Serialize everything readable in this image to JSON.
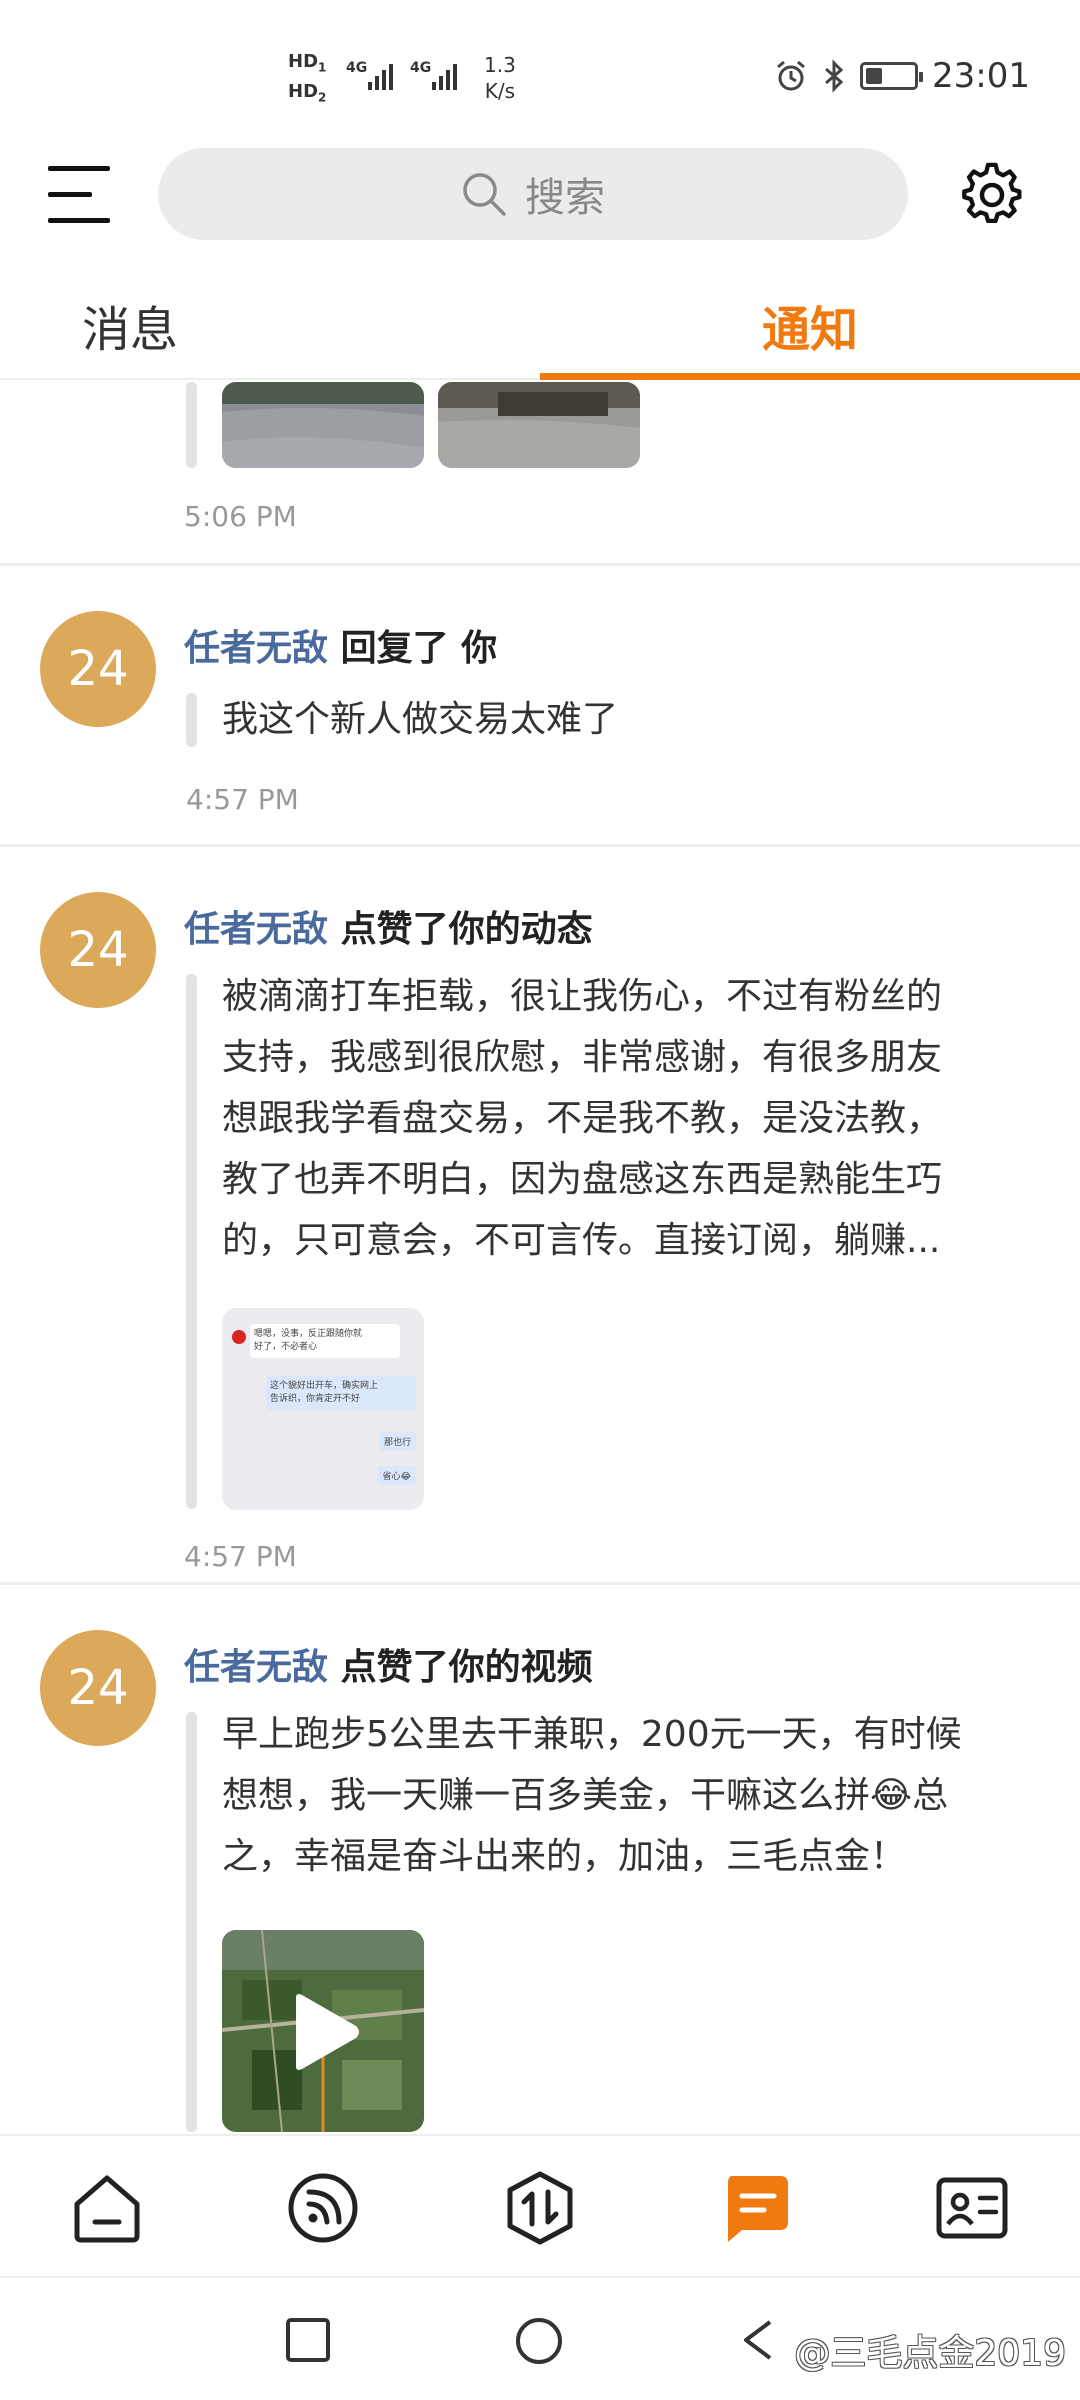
{
  "status_bar": {
    "hd1": "HD",
    "hd1_sub": "1",
    "hd2": "HD",
    "hd2_sub": "2",
    "net1": "4G",
    "net2": "4G",
    "speed_value": "1.3",
    "speed_unit": "K/s",
    "time": "23:01",
    "battery_level": 0.35
  },
  "header": {
    "menu_icon": "hamburger-icon",
    "search_placeholder": "搜索",
    "settings_icon": "gear-icon"
  },
  "tabs": [
    {
      "label": "消息",
      "active": false
    },
    {
      "label": "通知",
      "active": true
    }
  ],
  "accent_color": "#f07a10",
  "feed": {
    "partial_item": {
      "time": "5:06 PM"
    },
    "items": [
      {
        "avatar_text": "24",
        "user": "任者无敌",
        "action": "回复了 你",
        "content": [
          "我这个新人做交易太难了"
        ],
        "time": "4:57 PM"
      },
      {
        "avatar_text": "24",
        "user": "任者无敌",
        "action": "点赞了你的动态",
        "content": [
          "被滴滴打车拒载，很让我伤心，不过有粉丝的",
          "支持，我感到很欣慰，非常感谢，有很多朋友",
          "想跟我学看盘交易，不是我不教，是没法教，",
          "教了也弄不明白，因为盘感这东西是熟能生巧",
          "的，只可意会，不可言传。直接订阅，躺赚..."
        ],
        "thumb_text": [
          "嗯嗯，没事，反正跟随你就",
          "好了，不必者心",
          "这个貌好出开车，确实网上",
          "告诉织，你肯定开不好",
          "那也行",
          "省心😂"
        ],
        "time": "4:57 PM"
      },
      {
        "avatar_text": "24",
        "user": "任者无敌",
        "action": "点赞了你的视频",
        "content": [
          "早上跑步5公里去干兼职，200元一天，有时候",
          "想想，我一天赚一百多美金，干嘛这么拼😂总",
          "之，幸福是奋斗出来的，加油，三毛点金！"
        ]
      }
    ]
  },
  "bottom_nav": [
    {
      "icon": "home-icon",
      "active": false
    },
    {
      "icon": "feed-icon",
      "active": false
    },
    {
      "icon": "trade-icon",
      "active": false
    },
    {
      "icon": "message-icon",
      "active": true
    },
    {
      "icon": "profile-card-icon",
      "active": false
    }
  ],
  "system_nav": {
    "recent_icon": "square-icon",
    "home_icon": "circle-icon",
    "watermark": "@三毛点金2019"
  }
}
